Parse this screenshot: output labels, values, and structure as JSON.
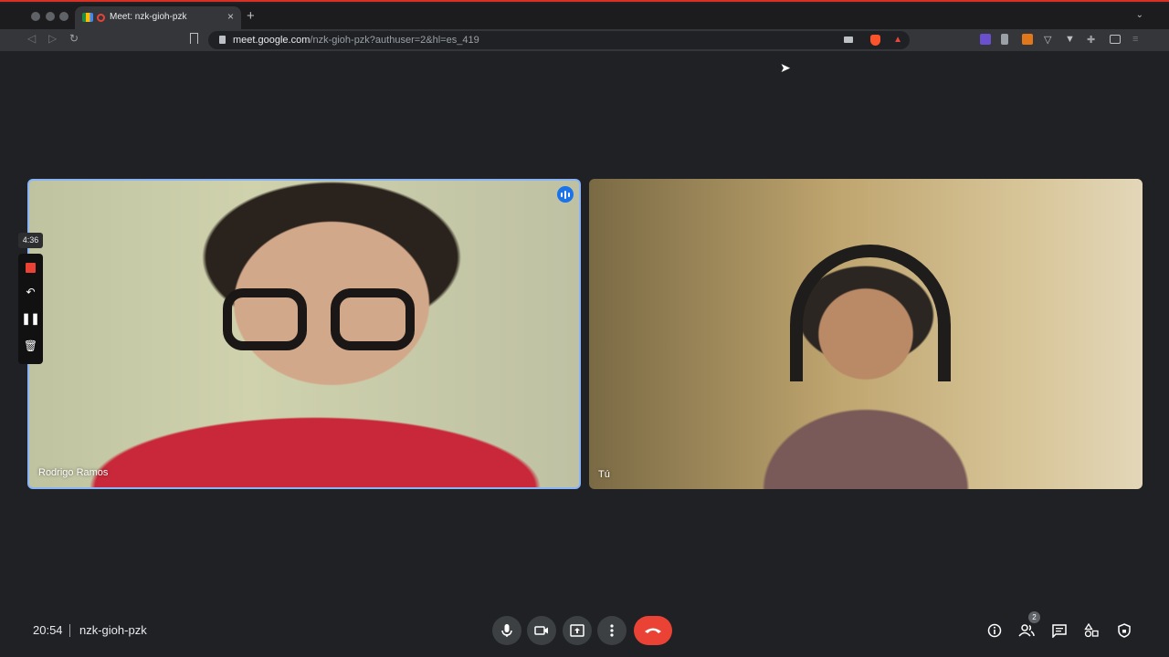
{
  "browser": {
    "tab_title": "Meet: nzk-gioh-pzk",
    "tab_close": "×",
    "new_tab": "+",
    "url_host": "meet.google.com",
    "url_path": "/nzk-gioh-pzk?authuser=2&hl=es_419"
  },
  "recorder": {
    "elapsed": "4:36"
  },
  "participants": [
    {
      "name": "Rodrigo Ramos",
      "speaking": true
    },
    {
      "name": "Tú",
      "speaking": false
    }
  ],
  "meeting": {
    "time": "20:54",
    "code": "nzk-gioh-pzk",
    "people_count": "2"
  },
  "colors": {
    "background": "#202124",
    "speaking_border": "#8ab4f8",
    "end_call": "#ea4335",
    "control": "#3c4043"
  }
}
